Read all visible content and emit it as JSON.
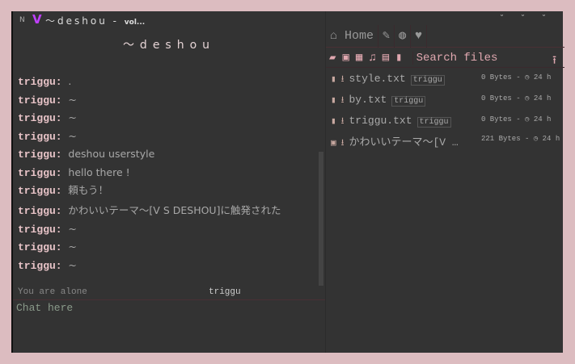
{
  "title": {
    "mode": "N",
    "logo": "V",
    "text": "～deshou - ",
    "suffix": "vol..."
  },
  "window_controls": [
    "˘",
    "˘",
    "˘"
  ],
  "room_title": "～deshou",
  "messages": [
    {
      "user": "triggu:",
      "text": "."
    },
    {
      "user": "triggu:",
      "text": "~"
    },
    {
      "user": "triggu:",
      "text": "~"
    },
    {
      "user": "triggu:",
      "text": "~"
    },
    {
      "user": "triggu:",
      "text": "deshou userstyle"
    },
    {
      "user": "triggu:",
      "text": "hello there !"
    },
    {
      "user": "triggu:",
      "text": "頼もう！"
    },
    {
      "user": "triggu:",
      "text": "かわいいテーマ～[V S DESHOU]に触発された"
    },
    {
      "user": "triggu:",
      "text": "~"
    },
    {
      "user": "triggu:",
      "text": "~"
    },
    {
      "user": "triggu:",
      "text": "~"
    }
  ],
  "status": {
    "text": "You are alone",
    "user": "triggu"
  },
  "chat_placeholder": "Chat here",
  "nav": {
    "home": "Home"
  },
  "search_placeholder": "Search files",
  "files": [
    {
      "name": "style.txt",
      "tag": "triggu",
      "meta": "0 Bytes - ◷ 24 h",
      "type": "file"
    },
    {
      "name": "by.txt",
      "tag": "triggu",
      "meta": "0 Bytes - ◷ 24 h",
      "type": "file"
    },
    {
      "name": "triggu.txt",
      "tag": "triggu",
      "meta": "0 Bytes - ◷ 24 h",
      "type": "file"
    },
    {
      "name": "かわいいテーマ～[V …",
      "tag": "",
      "meta": "221 Bytes - ◷ 24 h",
      "type": "image"
    }
  ]
}
